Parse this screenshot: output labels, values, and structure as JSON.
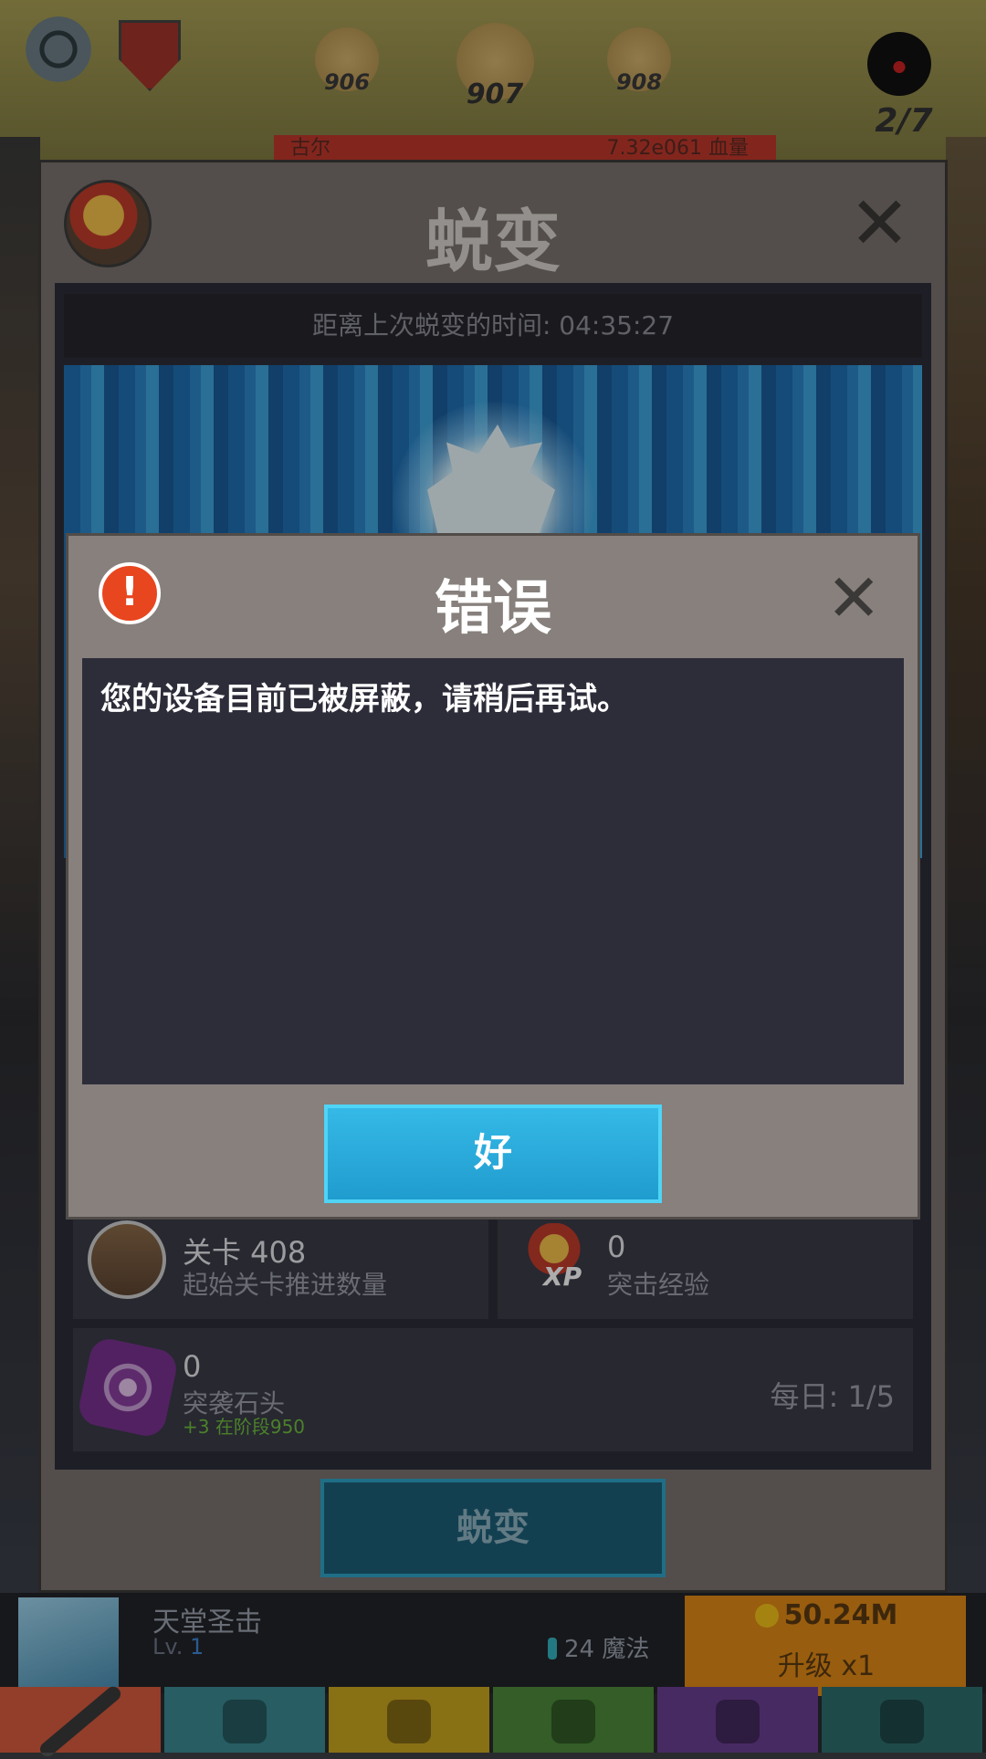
{
  "hud": {
    "stages": {
      "previous": "906",
      "current": "907",
      "next": "908"
    },
    "boss_count": "2/7",
    "enemy_name": "古尔",
    "enemy_hp": "7.32e061 血量"
  },
  "evolve_panel": {
    "title": "蜕变",
    "timer_text": "距离上次蜕变的时间: 04:35:27",
    "stage_reward": {
      "value": "关卡 408",
      "label": "起始关卡推进数量"
    },
    "xp_reward": {
      "value": "0",
      "label": "突击经验",
      "tag": "XP"
    },
    "stone_reward": {
      "value": "0",
      "label": "突袭石头",
      "bonus": "+3 在阶段950",
      "daily": "每日: 1/5"
    },
    "button_label": "蜕变"
  },
  "skill": {
    "name": "天堂圣击",
    "level_prefix": "Lv.",
    "level": "1",
    "mana_cost": "24 魔法",
    "gold": "50.24M",
    "upgrade_label": "升级 x1"
  },
  "tabs": [
    {
      "name": "sword",
      "color": "#d85c3f"
    },
    {
      "name": "hero",
      "color": "#3a8a93"
    },
    {
      "name": "equipment",
      "color": "#c9a51f"
    },
    {
      "name": "pet",
      "color": "#4d8a3a"
    },
    {
      "name": "artifact",
      "color": "#6b3f93"
    },
    {
      "name": "shop",
      "color": "#2f6d6d"
    }
  ],
  "error_dialog": {
    "title": "错误",
    "alert_icon": "!",
    "message": "您的设备目前已被屏蔽，请稍后再试。",
    "ok_label": "好",
    "close_icon": "close-icon"
  },
  "colors": {
    "accent_blue": "#209ccf",
    "alert_red": "#e8461f",
    "panel_gray": "#87807c"
  }
}
